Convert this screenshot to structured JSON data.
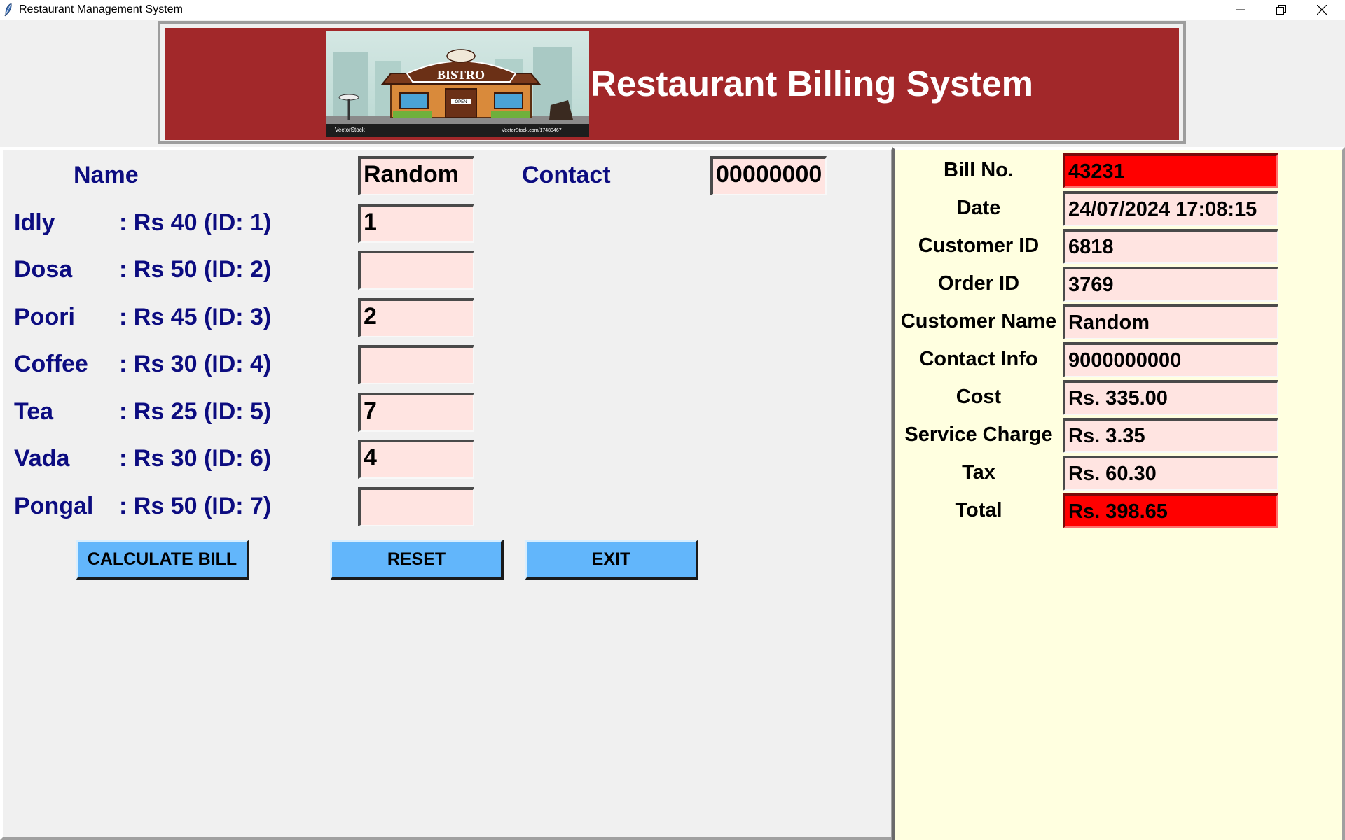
{
  "window": {
    "title": "Restaurant Management System",
    "icons": [
      "feather-icon",
      "minimize-icon",
      "restore-icon",
      "close-icon"
    ]
  },
  "header": {
    "title": "Restaurant Billing System",
    "logo": {
      "sign_text": "BISTRO",
      "door_text": "OPEN",
      "watermark_left": "VectorStock",
      "watermark_right": "VectorStock.com/17480467"
    },
    "colors": {
      "banner": "#a2282a"
    }
  },
  "customer": {
    "name_label": "Name",
    "name_value": "Random",
    "contact_label": "Contact",
    "contact_value": "00000000"
  },
  "menu": {
    "items": [
      {
        "name": "Idly",
        "price": ": Rs 40 (ID: 1)",
        "qty": "1"
      },
      {
        "name": "Dosa",
        "price": ": Rs 50 (ID: 2)",
        "qty": ""
      },
      {
        "name": "Poori",
        "price": ": Rs 45 (ID: 3)",
        "qty": "2"
      },
      {
        "name": "Coffee",
        "price": ": Rs 30 (ID: 4)",
        "qty": ""
      },
      {
        "name": "Tea",
        "price": ": Rs 25 (ID: 5)",
        "qty": "7"
      },
      {
        "name": "Vada",
        "price": ": Rs 30 (ID: 6)",
        "qty": "4"
      },
      {
        "name": "Pongal",
        "price": ": Rs 50 (ID: 7)",
        "qty": ""
      }
    ]
  },
  "buttons": {
    "calculate": "CALCULATE BILL",
    "reset": "RESET",
    "exit": "EXIT"
  },
  "bill": {
    "fields": [
      {
        "label": "Bill No.",
        "value": "43231",
        "highlight": true
      },
      {
        "label": "Date",
        "value": "24/07/2024 17:08:15",
        "highlight": false
      },
      {
        "label": "Customer ID",
        "value": "6818",
        "highlight": false
      },
      {
        "label": "Order ID",
        "value": "3769",
        "highlight": false
      },
      {
        "label": "Customer Name",
        "value": "Random",
        "highlight": false
      },
      {
        "label": "Contact Info",
        "value": "9000000000",
        "highlight": false
      },
      {
        "label": "Cost",
        "value": "Rs. 335.00",
        "highlight": false
      },
      {
        "label": "Service Charge",
        "value": "Rs. 3.35",
        "highlight": false
      },
      {
        "label": "Tax",
        "value": "Rs. 60.30",
        "highlight": false
      },
      {
        "label": "Total",
        "value": "Rs. 398.65",
        "highlight": true
      }
    ]
  },
  "colors": {
    "label_blue": "#0c0c80",
    "entry_bg": "#ffe4e1",
    "highlight_red": "#ff0000",
    "button_blue": "#62b6fb",
    "right_panel_bg": "#ffffe0"
  }
}
